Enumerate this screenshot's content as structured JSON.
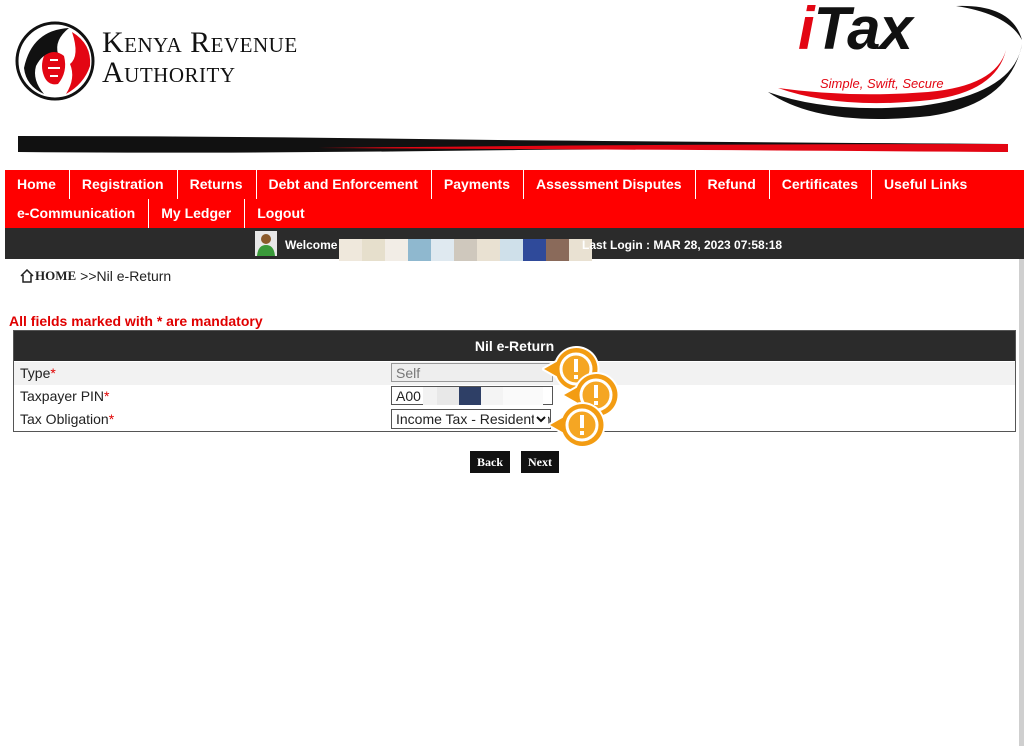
{
  "header": {
    "org_line1": "Kenya Revenue",
    "org_line2": "Authority",
    "itax_i": "i",
    "itax_rest": "Tax",
    "itax_tagline": "Simple, Swift, Secure"
  },
  "nav": {
    "row1": [
      "Home",
      "Registration",
      "Returns",
      "Debt and Enforcement",
      "Payments",
      "Assessment Disputes",
      "Refund",
      "Certificates",
      "Useful Links"
    ],
    "row2": [
      "e-Communication",
      "My Ledger",
      "Logout"
    ]
  },
  "welcome": {
    "label": "Welcome",
    "last_login": "Last Login : MAR 28, 2023 07:58:18"
  },
  "breadcrumb": {
    "home": "HOME",
    "current": ">>Nil e-Return"
  },
  "form": {
    "mandatory_note": "All fields marked with * are mandatory",
    "title": "Nil e-Return",
    "type_label": "Type",
    "type_value": "Self",
    "pin_label": "Taxpayer PIN",
    "pin_value": "A00",
    "obligation_label": "Tax Obligation",
    "obligation_value": "Income Tax - Resident Individual",
    "required_mark": "*"
  },
  "buttons": {
    "back": "Back",
    "next": "Next"
  },
  "colors": {
    "nav_red": "#ff0000",
    "dark_bar": "#2b2b2b",
    "alert_orange": "#f39c12",
    "required_red": "#e00000"
  },
  "icons": {
    "validation": "warning-exclamation-icon",
    "user": "user-avatar-icon",
    "home": "home-icon"
  }
}
